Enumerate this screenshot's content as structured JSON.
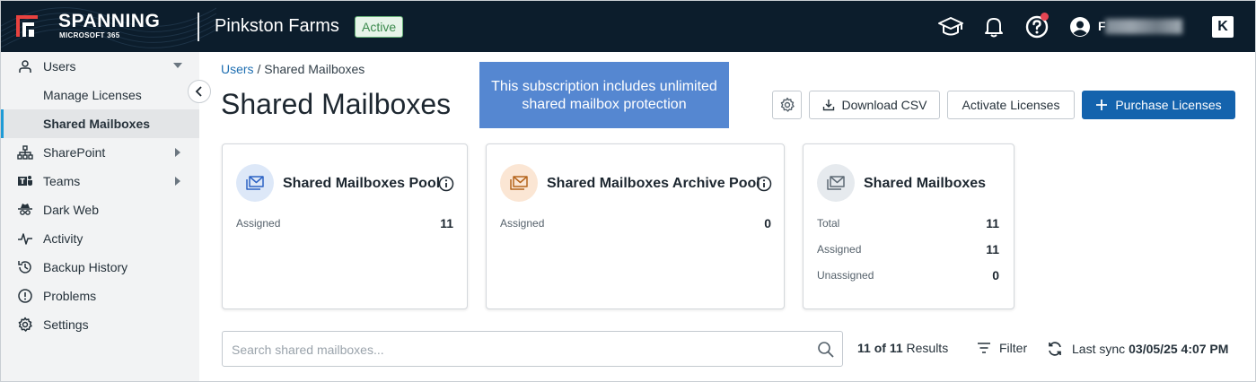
{
  "brand": {
    "name": "SPANNING",
    "sub": "MICROSOFT 365"
  },
  "header": {
    "org_name": "Pinkston Farms",
    "status": "Active",
    "user_name": "F",
    "k_badge": "K"
  },
  "sidebar": {
    "items": [
      {
        "label": "Users",
        "icon": "user-icon"
      },
      {
        "label": "Manage Licenses"
      },
      {
        "label": "Shared Mailboxes"
      },
      {
        "label": "SharePoint",
        "icon": "sitemap-icon"
      },
      {
        "label": "Teams",
        "icon": "teams-icon"
      },
      {
        "label": "Dark Web",
        "icon": "spy-icon"
      },
      {
        "label": "Activity",
        "icon": "activity-icon"
      },
      {
        "label": "Backup History",
        "icon": "history-icon"
      },
      {
        "label": "Problems",
        "icon": "alert-icon"
      },
      {
        "label": "Settings",
        "icon": "gear-icon"
      }
    ]
  },
  "breadcrumb": {
    "link": "Users",
    "separator": " / ",
    "current": "Shared Mailboxes"
  },
  "page": {
    "title": "Shared Mailboxes"
  },
  "tooltip": {
    "text": "This subscription includes unlimited shared mailbox protection"
  },
  "toolbar": {
    "download": "Download CSV",
    "activate": "Activate Licenses",
    "purchase": "Purchase Licenses"
  },
  "cards": [
    {
      "title": "Shared Mailboxes Pool",
      "rows": [
        {
          "label": "Assigned",
          "value": "11"
        }
      ]
    },
    {
      "title": "Shared Mailboxes Archive Pool",
      "rows": [
        {
          "label": "Assigned",
          "value": "0"
        }
      ]
    },
    {
      "title": "Shared Mailboxes",
      "rows": [
        {
          "label": "Total",
          "value": "11"
        },
        {
          "label": "Assigned",
          "value": "11"
        },
        {
          "label": "Unassigned",
          "value": "0"
        }
      ]
    }
  ],
  "search": {
    "placeholder": "Search shared mailboxes..."
  },
  "results": {
    "shown": "11",
    "of_word": "of",
    "total": "11",
    "suffix": "Results"
  },
  "filter": {
    "label": "Filter"
  },
  "sync": {
    "label": "Last sync",
    "value": "03/05/25 4:07 PM"
  },
  "colors": {
    "topbar": "#0c1d2c",
    "primary": "#1463ad",
    "tooltip": "#5587d1",
    "active_accent": "#1f9bd6",
    "archive_accent": "#b5651d"
  }
}
